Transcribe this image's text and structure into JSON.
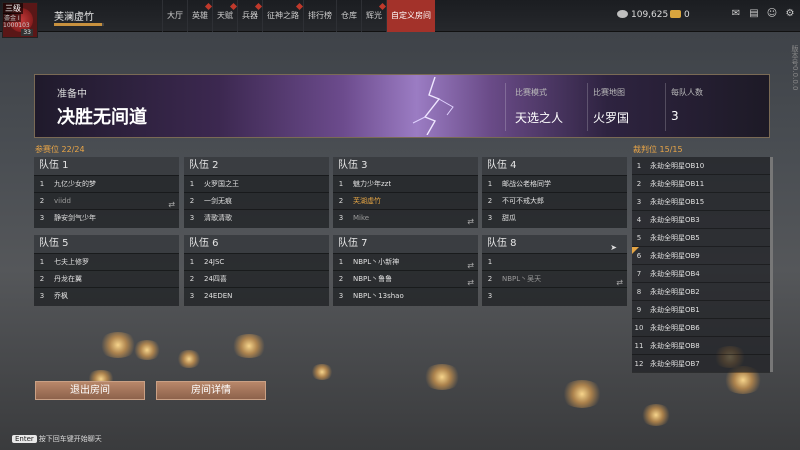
{
  "player": {
    "level": "三级",
    "rank": "鎏金 I",
    "uid": "1000103",
    "badge": "33",
    "name": "芙澜虚竹",
    "exp_progress": 0.95
  },
  "nav": [
    {
      "label": "大厅",
      "alert": false
    },
    {
      "label": "英雄",
      "alert": true
    },
    {
      "label": "天赋",
      "alert": true
    },
    {
      "label": "兵器",
      "alert": true
    },
    {
      "label": "征神之路",
      "alert": true
    },
    {
      "label": "排行榜",
      "alert": false
    },
    {
      "label": "仓库",
      "alert": false
    },
    {
      "label": "辉光",
      "alert": true
    },
    {
      "label": "自定义房间",
      "alert": false,
      "active": true
    }
  ],
  "currency": {
    "coins": "109,625",
    "gold": "0"
  },
  "top_icons": [
    "mail-icon",
    "message-icon",
    "friends-icon",
    "settings-icon"
  ],
  "version_text": "版本号0.0.0.0",
  "room": {
    "status": "准备中",
    "name": "决胜无间道",
    "mode_label": "比赛模式",
    "mode": "天选之人",
    "map_label": "比赛地图",
    "map": "火罗国",
    "size_label": "每队人数",
    "size": "3"
  },
  "participants_label": "参赛位  22/24",
  "teams": [
    {
      "name": "队伍 1",
      "players": [
        {
          "n": "1",
          "name": "九亿少女的梦"
        },
        {
          "n": "2",
          "name": "viidd",
          "dim": true,
          "swap": true
        },
        {
          "n": "3",
          "name": "静安剑气少年"
        }
      ]
    },
    {
      "name": "队伍 2",
      "players": [
        {
          "n": "1",
          "name": "火罗国之王"
        },
        {
          "n": "2",
          "name": "一剑无痕"
        },
        {
          "n": "3",
          "name": "清歌清歌"
        }
      ]
    },
    {
      "name": "队伍 3",
      "players": [
        {
          "n": "1",
          "name": "魅力少年zzt"
        },
        {
          "n": "2",
          "name": "芙湖虚竹",
          "gold": true
        },
        {
          "n": "3",
          "name": "Mike",
          "dim": true,
          "swap": true
        }
      ]
    },
    {
      "name": "队伍 4",
      "players": [
        {
          "n": "1",
          "name": "邮战公老格同学"
        },
        {
          "n": "2",
          "name": "不可不戒大郎"
        },
        {
          "n": "3",
          "name": "甜瓜"
        }
      ]
    },
    {
      "name": "队伍 5",
      "players": [
        {
          "n": "1",
          "name": "七夫上修罗"
        },
        {
          "n": "2",
          "name": "丹龙在翼"
        },
        {
          "n": "3",
          "name": "乔枫"
        }
      ]
    },
    {
      "name": "队伍 6",
      "players": [
        {
          "n": "1",
          "name": "24JSC"
        },
        {
          "n": "2",
          "name": "24四喜"
        },
        {
          "n": "3",
          "name": "24EDEN"
        }
      ]
    },
    {
      "name": "队伍 7",
      "players": [
        {
          "n": "1",
          "name": "NBPL丶小新神",
          "swap": true
        },
        {
          "n": "2",
          "name": "NBPL丶鲁鲁",
          "swap": true
        },
        {
          "n": "3",
          "name": "NBPL丶13shao"
        }
      ]
    },
    {
      "name": "队伍 8",
      "players": [
        {
          "n": "1",
          "name": ""
        },
        {
          "n": "2",
          "name": "NBPL丶吴天",
          "dim": true,
          "swap": true
        },
        {
          "n": "3",
          "name": ""
        }
      ]
    }
  ],
  "referees_label": "裁判位  15/15",
  "referees": [
    {
      "n": "1",
      "name": "永劫全明星OB10"
    },
    {
      "n": "2",
      "name": "永劫全明星OB11"
    },
    {
      "n": "3",
      "name": "永劫全明星OB15"
    },
    {
      "n": "4",
      "name": "永劫全明星OB3"
    },
    {
      "n": "5",
      "name": "永劫全明星OB5"
    },
    {
      "n": "6",
      "name": "永劫全明星OB9",
      "flag": true
    },
    {
      "n": "7",
      "name": "永劫全明星OB4"
    },
    {
      "n": "8",
      "name": "永劫全明星OB2"
    },
    {
      "n": "9",
      "name": "永劫全明星OB1"
    },
    {
      "n": "10",
      "name": "永劫全明星OB6"
    },
    {
      "n": "11",
      "name": "永劫全明星OB8"
    },
    {
      "n": "12",
      "name": "永劫全明星OB7"
    }
  ],
  "buttons": {
    "exit": "退出房间",
    "details": "房间详情"
  },
  "chat_hint": {
    "key": "Enter",
    "text": "按下回车键开始聊天"
  },
  "colors": {
    "accent": "#a3322a",
    "gold": "#e4a444",
    "button": "#a7765c"
  }
}
